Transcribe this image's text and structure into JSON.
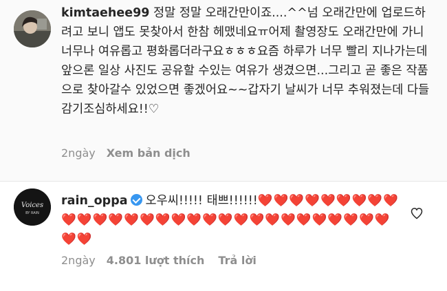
{
  "comment1": {
    "username": "kimtaehee99",
    "text": "정말 정말 오래간만이죠....^^넘 오래간만에 업로드하려고 보니 앱도 못찾아서 한참 헤맸네요ㅠ어제 촬영장도 오래간만에 가니 너무나 여유롭고 평화롭더라구요ㅎㅎㅎ요즘 하루가 너무 빨리 지나가는데 앞으론 일상 사진도 공유할 수있는 여유가 생겼으면...그리고 곧 좋은 작품으로 찾아갈수 있었으면 좋겠어요~~갑자기 날씨가 너무 추워졌는데 다들 감기조심하세요!!♡",
    "time": "2ngày",
    "translate": "Xem bản dịch"
  },
  "comment2": {
    "username": "rain_oppa",
    "text_prefix": "오우씨!!!!! 태쁘!!!!!!",
    "hearts": "❤️❤️❤️❤️❤️❤️❤️❤️❤️❤️❤️❤️❤️❤️❤️❤️❤️❤️❤️❤️❤️❤️❤️❤️❤️❤️❤️❤️❤️❤️❤️❤️",
    "time": "2ngày",
    "likes": "4.801 lượt thích",
    "reply": "Trả lời"
  },
  "colors": {
    "verified": "#3897f0",
    "heart": "#ed1c24",
    "meta": "#8e8e8e"
  }
}
